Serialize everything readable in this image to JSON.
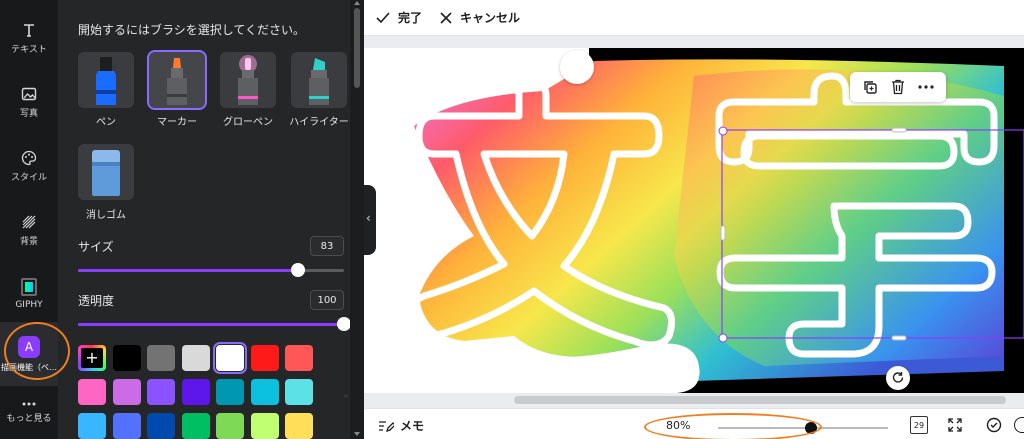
{
  "sidebar": {
    "items": [
      {
        "label": "テキスト",
        "icon": "text-icon"
      },
      {
        "label": "写真",
        "icon": "photo-icon"
      },
      {
        "label": "スタイル",
        "icon": "palette-icon"
      },
      {
        "label": "背景",
        "icon": "pattern-icon"
      },
      {
        "label": "GIPHY",
        "icon": "giphy-icon"
      },
      {
        "label": "描画機能（ベ…",
        "icon": "draw-app-icon"
      },
      {
        "label": "もっと見る",
        "icon": "more-icon"
      }
    ]
  },
  "panel": {
    "heading": "開始するにはブラシを選択してください。",
    "brushes": [
      {
        "label": "ペン",
        "color": "#1a6bff"
      },
      {
        "label": "マーカー",
        "color": "#ff7a2f"
      },
      {
        "label": "グローペン",
        "color": "#ff55c7"
      },
      {
        "label": "ハイライター",
        "color": "#2fd0c8"
      },
      {
        "label": "消しゴム",
        "color": "#5f9bdb"
      }
    ],
    "selected_brush": "マーカー",
    "size": {
      "label": "サイズ",
      "value": "83",
      "fraction": 0.83
    },
    "opacity": {
      "label": "透明度",
      "value": "100",
      "fraction": 1.0
    },
    "colors": [
      "#ffffff",
      "#000000",
      "#737373",
      "#d9d9d9",
      "#ffffff",
      "#ff1a1a",
      "#ff5757",
      "#ff66c4",
      "#cb6ce6",
      "#8c52ff",
      "#5e17eb",
      "#0097b2",
      "#0cc0df",
      "#5ce1e6",
      "#38b6ff",
      "#5271ff",
      "#004aad",
      "#00bf63",
      "#7ed957",
      "#c1ff72",
      "#ffde59"
    ],
    "add_color_symbol": "+"
  },
  "toolbar": {
    "done_label": "完了",
    "cancel_label": "キャンセル"
  },
  "canvas": {
    "text_char1": "文",
    "text_char2": "字"
  },
  "bottom": {
    "memo_label": "メモ",
    "zoom_label": "80%",
    "zoom_fraction": 0.52,
    "pages_label": "29"
  }
}
